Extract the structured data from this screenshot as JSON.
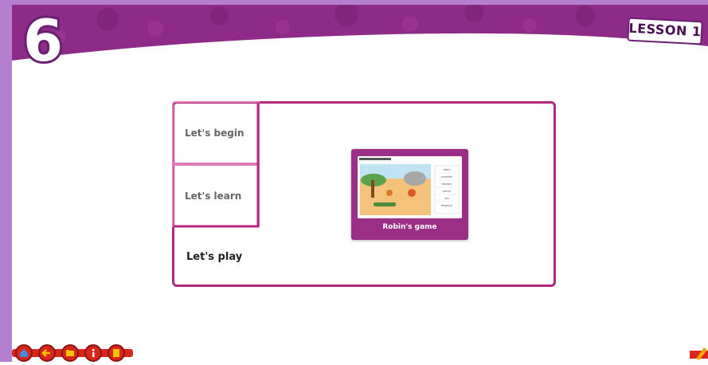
{
  "header": {
    "unit_number": "6",
    "lesson_label": "LESSON 1"
  },
  "menu": {
    "items": [
      {
        "label": "Let's begin",
        "active": false
      },
      {
        "label": "Let's learn",
        "active": false
      },
      {
        "label": "Let's play",
        "active": true
      }
    ]
  },
  "game_card": {
    "title": "Robin's game",
    "thumbnail_words": [
      "zebra",
      "crocodile",
      "monkey",
      "parrot",
      "lion",
      "elephant"
    ]
  },
  "toolbar": {
    "icons": [
      "home-icon",
      "back-arrow-icon",
      "folder-icon",
      "info-icon",
      "notebook-icon"
    ],
    "right_icon": "pencil-icon"
  },
  "colors": {
    "banner_purple": "#8e2a87",
    "accent_magenta": "#b3287e",
    "light_pink": "#e07cb8",
    "toolbar_red": "#d9261c",
    "side_lavender": "#b57fd0"
  }
}
